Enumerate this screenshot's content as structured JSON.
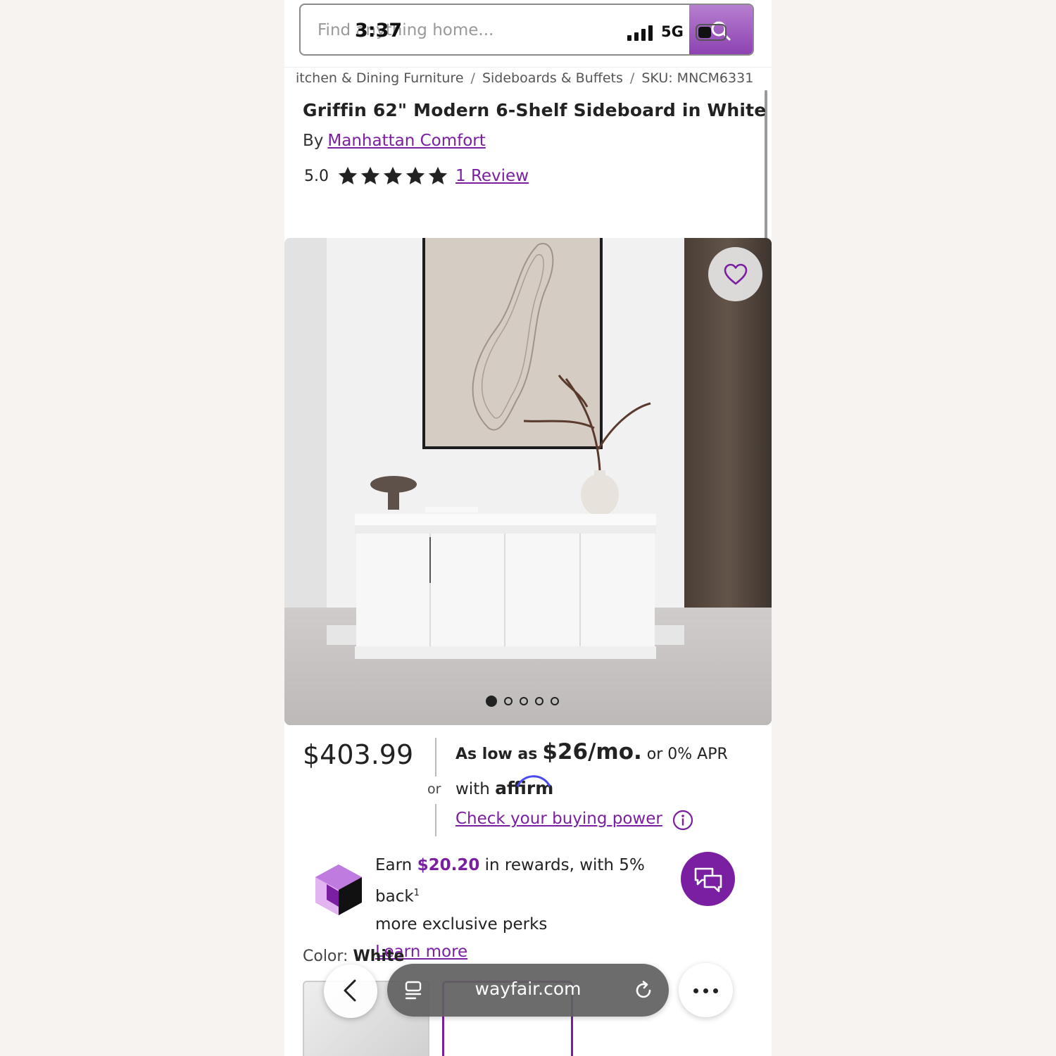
{
  "status_bar": {
    "time": "3:37",
    "network": "5G"
  },
  "search": {
    "placeholder": "Find anything home..."
  },
  "breadcrumb": [
    "itchen & Dining Furniture",
    "Sideboards & Buffets",
    "SKU: MNCM6331"
  ],
  "product": {
    "title": "Griffin 62\" Modern 6-Shelf Sideboard in White",
    "by_label": "By",
    "brand": "Manhattan Comfort",
    "rating": "5.0",
    "stars": 5,
    "reviews_label": "1 Review"
  },
  "gallery": {
    "image_count": 5,
    "active_index": 0
  },
  "pricing": {
    "price": "$403.99",
    "or_label": "or",
    "as_low_as": "As low as",
    "monthly": "$26/mo.",
    "apr_text": "or 0% APR",
    "with_label": "with",
    "affirm": "affirm",
    "check_link": "Check your buying power"
  },
  "rewards": {
    "earn": "Earn",
    "amount": "$20.20",
    "text": "in rewards, with 5% back",
    "sup": "1",
    "text2": "more exclusive perks",
    "learn_more": "Learn more"
  },
  "color": {
    "label": "Color:",
    "value": "White"
  },
  "browser": {
    "url": "wayfair.com"
  },
  "colors": {
    "accent": "#7b1fa2"
  }
}
